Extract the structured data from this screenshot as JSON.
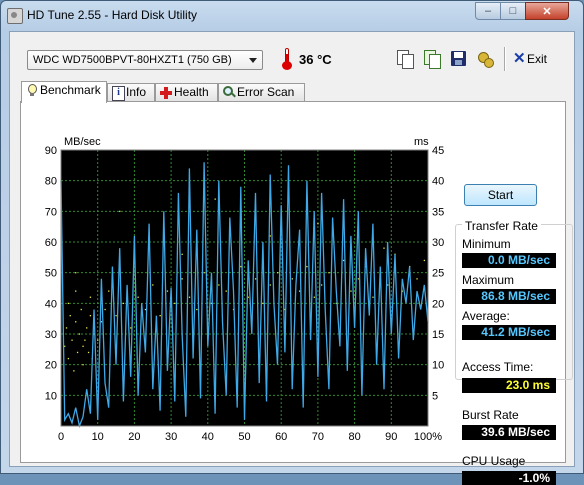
{
  "window": {
    "title": "HD Tune 2.55 - Hard Disk Utility",
    "min_glyph": "–",
    "max_glyph": "□",
    "close_glyph": "✕"
  },
  "toolbar": {
    "drive": "WDC WD7500BPVT-80HXZT1 (750 GB)",
    "temperature": "36 °C",
    "exit_label": "Exit",
    "icons": [
      "copy-text-icon",
      "copy-screenshot-icon",
      "save-icon",
      "options-icon"
    ]
  },
  "tabs": [
    {
      "label": "Benchmark",
      "icon": "bulb-icon",
      "active": true
    },
    {
      "label": "Info",
      "icon": "info-icon",
      "active": false
    },
    {
      "label": "Health",
      "icon": "health-cross-icon",
      "active": false
    },
    {
      "label": "Error Scan",
      "icon": "magnifier-icon",
      "active": false
    }
  ],
  "benchmark": {
    "start_label": "Start",
    "transfer_rate_title": "Transfer Rate",
    "minimum_label": "Minimum",
    "minimum_value": "0.0 MB/sec",
    "maximum_label": "Maximum",
    "maximum_value": "86.8 MB/sec",
    "average_label": "Average:",
    "average_value": "41.2 MB/sec",
    "access_time_label": "Access Time:",
    "access_time_value": "23.0 ms",
    "burst_rate_label": "Burst Rate",
    "burst_rate_value": "39.6 MB/sec",
    "cpu_usage_label": "CPU Usage",
    "cpu_usage_value": "-1.0%"
  },
  "colors": {
    "plot_background": "#000000",
    "transfer_line": "#3fa8e6",
    "access_points": "#e8e84a",
    "grid": "#2f8a2f",
    "value_cyan": "#55c8ff",
    "value_yellow": "#ffff33"
  },
  "chart_data": {
    "type": "line",
    "ylabel_left": "MB/sec",
    "ylabel_right": "ms",
    "x_ticks": [
      "0",
      "10",
      "20",
      "30",
      "40",
      "50",
      "60",
      "70",
      "80",
      "90",
      "100%"
    ],
    "y_left_ticks": [
      "10",
      "20",
      "30",
      "40",
      "50",
      "60",
      "70",
      "80",
      "90"
    ],
    "y_right_ticks": [
      "5",
      "10",
      "15",
      "20",
      "25",
      "30",
      "35",
      "40",
      "45"
    ],
    "xlim": [
      0,
      100
    ],
    "ylim_left": [
      0,
      90
    ],
    "ylim_right": [
      0,
      45
    ],
    "grid": true,
    "series": [
      {
        "kind": "transfer_rate_mb_s",
        "x": [
          0,
          1,
          2,
          3,
          4,
          5,
          6,
          7,
          8,
          9,
          10,
          11,
          12,
          13,
          14,
          15,
          16,
          17,
          18,
          19,
          20,
          21,
          22,
          23,
          24,
          25,
          26,
          27,
          28,
          29,
          30,
          31,
          32,
          33,
          34,
          35,
          36,
          37,
          38,
          39,
          40,
          41,
          42,
          43,
          44,
          45,
          46,
          47,
          48,
          49,
          50,
          51,
          52,
          53,
          54,
          55,
          56,
          57,
          58,
          59,
          60,
          61,
          62,
          63,
          64,
          65,
          66,
          67,
          68,
          69,
          70,
          71,
          72,
          73,
          74,
          75,
          76,
          77,
          78,
          79,
          80,
          81,
          82,
          83,
          84,
          85,
          86,
          87,
          88,
          89,
          90,
          91,
          92,
          93,
          94,
          95,
          96,
          97,
          98,
          99,
          100
        ],
        "values": [
          80,
          2,
          4,
          1,
          6,
          0,
          3,
          12,
          4,
          38,
          2,
          48,
          14,
          6,
          52,
          20,
          58,
          8,
          46,
          16,
          62,
          10,
          40,
          24,
          66,
          12,
          36,
          5,
          70,
          18,
          45,
          8,
          76,
          30,
          3,
          84,
          22,
          64,
          9,
          86,
          26,
          50,
          4,
          80,
          34,
          10,
          68,
          44,
          6,
          78,
          2,
          54,
          30,
          76,
          14,
          60,
          8,
          82,
          40,
          20,
          72,
          24,
          85,
          12,
          46,
          64,
          6,
          80,
          28,
          70,
          16,
          76,
          38,
          12,
          68,
          44,
          26,
          74,
          18,
          62,
          32,
          70,
          10,
          58,
          36,
          66,
          20,
          52,
          12,
          60,
          30,
          56,
          22,
          48,
          40,
          52,
          28,
          44,
          38,
          46,
          34
        ]
      },
      {
        "kind": "access_time_ms",
        "points": [
          [
            1,
            13
          ],
          [
            1.5,
            16
          ],
          [
            2,
            11
          ],
          [
            2.5,
            18
          ],
          [
            3,
            14
          ],
          [
            3.5,
            9
          ],
          [
            4,
            17
          ],
          [
            4.5,
            12
          ],
          [
            5,
            15
          ],
          [
            5.5,
            19
          ],
          [
            6,
            10
          ],
          [
            6.5,
            14
          ],
          [
            7,
            16
          ],
          [
            7.5,
            12
          ],
          [
            8,
            18
          ],
          [
            8.5,
            11
          ],
          [
            9,
            15
          ],
          [
            2,
            20
          ],
          [
            4,
            22
          ],
          [
            6,
            13
          ],
          [
            8,
            21
          ],
          [
            10,
            14
          ],
          [
            11,
            17
          ],
          [
            12,
            19
          ],
          [
            13,
            22
          ],
          [
            15,
            18
          ],
          [
            17,
            20
          ],
          [
            19,
            16
          ],
          [
            21,
            21
          ],
          [
            23,
            19
          ],
          [
            25,
            23
          ],
          [
            27,
            18
          ],
          [
            29,
            22
          ],
          [
            31,
            20
          ],
          [
            33,
            24
          ],
          [
            35,
            21
          ],
          [
            37,
            19
          ],
          [
            39,
            25
          ],
          [
            41,
            20
          ],
          [
            43,
            23
          ],
          [
            45,
            22
          ],
          [
            47,
            19
          ],
          [
            49,
            26
          ],
          [
            51,
            21
          ],
          [
            53,
            24
          ],
          [
            55,
            20
          ],
          [
            57,
            23
          ],
          [
            59,
            25
          ],
          [
            61,
            19
          ],
          [
            63,
            24
          ],
          [
            65,
            22
          ],
          [
            67,
            26
          ],
          [
            69,
            21
          ],
          [
            71,
            23
          ],
          [
            73,
            25
          ],
          [
            75,
            20
          ],
          [
            77,
            27
          ],
          [
            79,
            22
          ],
          [
            81,
            24
          ],
          [
            83,
            26
          ],
          [
            85,
            21
          ],
          [
            87,
            25
          ],
          [
            89,
            23
          ],
          [
            91,
            28
          ],
          [
            93,
            22
          ],
          [
            95,
            26
          ],
          [
            97,
            24
          ],
          [
            99,
            27
          ],
          [
            16,
            35
          ],
          [
            42,
            37
          ],
          [
            70,
            33
          ],
          [
            4,
            25
          ],
          [
            88,
            29
          ],
          [
            57,
            31
          ],
          [
            33,
            28
          ]
        ]
      }
    ]
  }
}
